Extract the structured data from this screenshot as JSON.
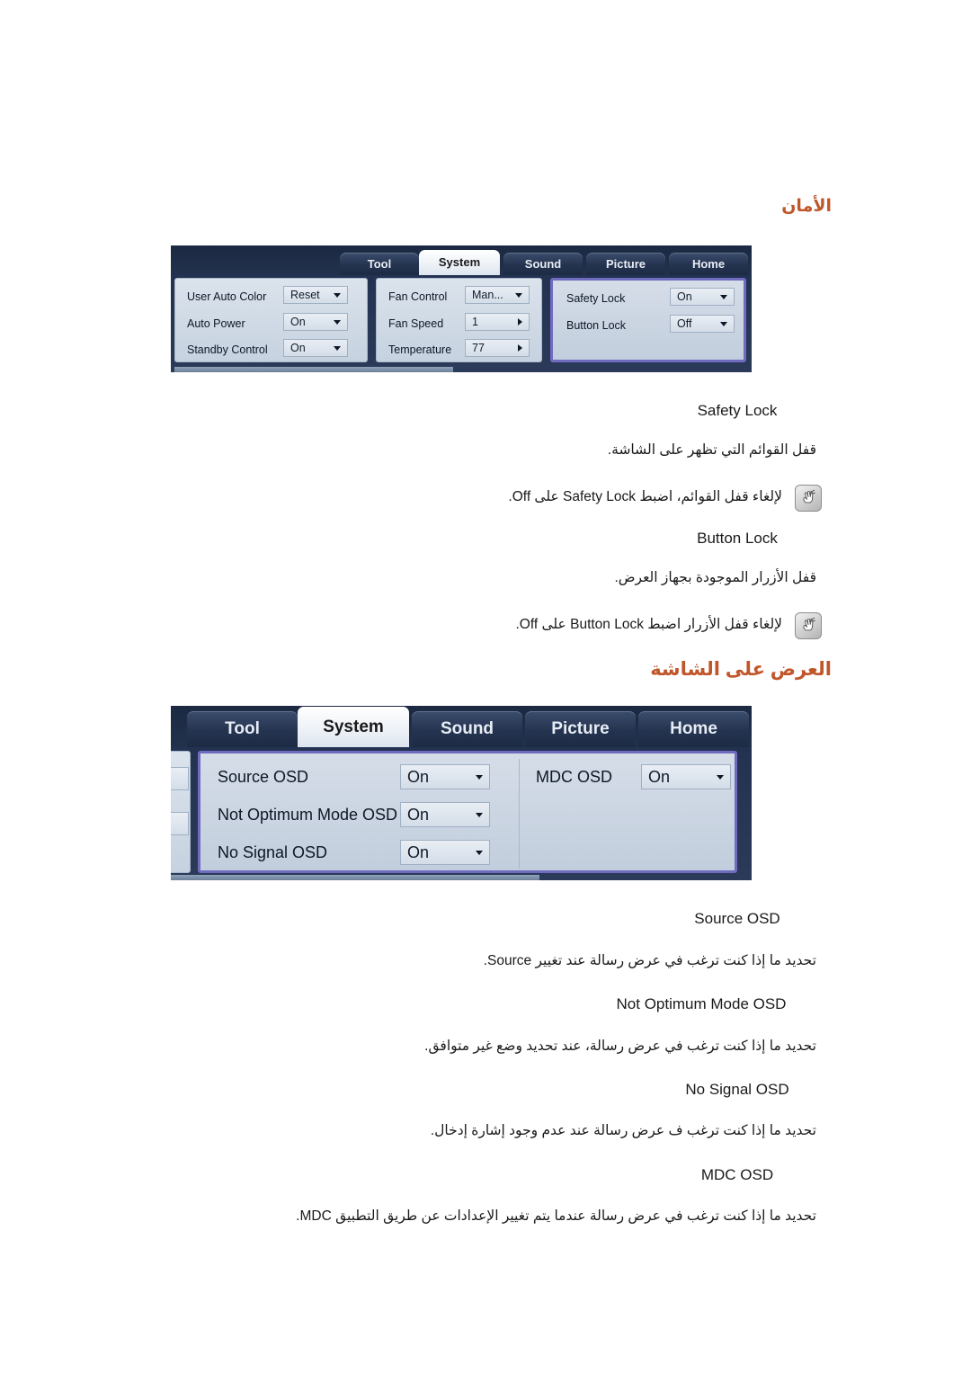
{
  "page": {
    "heading_security": "الأمان",
    "heading_osd": "العرض على الشاشة"
  },
  "mdc_security": {
    "tabs": [
      {
        "label": "Home",
        "active": false
      },
      {
        "label": "Picture",
        "active": false
      },
      {
        "label": "Sound",
        "active": false
      },
      {
        "label": "System",
        "active": true
      },
      {
        "label": "Tool",
        "active": false
      }
    ],
    "group_left": [
      {
        "label": "User Auto Color",
        "value": "Reset",
        "control": "dropdown"
      },
      {
        "label": "Auto Power",
        "value": "On",
        "control": "dropdown"
      },
      {
        "label": "Standby Control",
        "value": "On",
        "control": "dropdown"
      }
    ],
    "group_middle": [
      {
        "label": "Fan Control",
        "value": "Man...",
        "control": "dropdown"
      },
      {
        "label": "Fan Speed",
        "value": "1",
        "control": "spinner"
      },
      {
        "label": "Temperature",
        "value": "77",
        "control": "spinner"
      }
    ],
    "group_right": [
      {
        "label": "Safety Lock",
        "value": "On",
        "control": "dropdown"
      },
      {
        "label": "Button Lock",
        "value": "Off",
        "control": "dropdown"
      }
    ]
  },
  "mdc_osd": {
    "tabs": [
      {
        "label": "Home",
        "active": false
      },
      {
        "label": "Picture",
        "active": false
      },
      {
        "label": "Sound",
        "active": false
      },
      {
        "label": "System",
        "active": true
      },
      {
        "label": "Tool",
        "active": false
      }
    ],
    "group_left": [
      {
        "label": "Source OSD",
        "value": "On",
        "control": "dropdown"
      },
      {
        "label": "Not Optimum Mode OSD",
        "value": "On",
        "control": "dropdown"
      },
      {
        "label": "No Signal OSD",
        "value": "On",
        "control": "dropdown"
      }
    ],
    "group_right": [
      {
        "label": "MDC OSD",
        "value": "On",
        "control": "dropdown"
      }
    ]
  },
  "entries": {
    "safety_lock": {
      "term": "Safety Lock",
      "desc": "قفل القوائم التي تظهر على الشاشة.",
      "note": "لإلغاء قفل القوائم، اضبط Safety Lock على Off."
    },
    "button_lock": {
      "term": "Button Lock",
      "desc": "قفل الأزرار الموجودة بجهاز العرض.",
      "note": "لإلغاء قفل الأزرار اضبط Button Lock على Off."
    },
    "source_osd": {
      "term": "Source OSD",
      "desc": "تحديد ما إذا كنت ترغب في عرض رسالة عند تغيير Source."
    },
    "not_optimum_mode_osd": {
      "term": "Not Optimum Mode OSD",
      "desc": "تحديد ما إذا كنت ترغب في عرض رسالة، عند تحديد وضع غير متوافق."
    },
    "no_signal_osd": {
      "term": "No Signal OSD",
      "desc": "تحديد ما إذا كنت ترغب ف عرض رسالة عند عدم وجود إشارة إدخال."
    },
    "mdc_osd": {
      "term": "MDC OSD",
      "desc": "تحديد ما إذا كنت ترغب في عرض رسالة عندما يتم تغيير الإعدادات عن طريق التطبيق MDC."
    }
  },
  "icons": {
    "note": "note-hand-icon"
  },
  "colors": {
    "heading": "#c0562a",
    "highlight_border": "#6f6cc0",
    "panel_bg": "#223250"
  }
}
